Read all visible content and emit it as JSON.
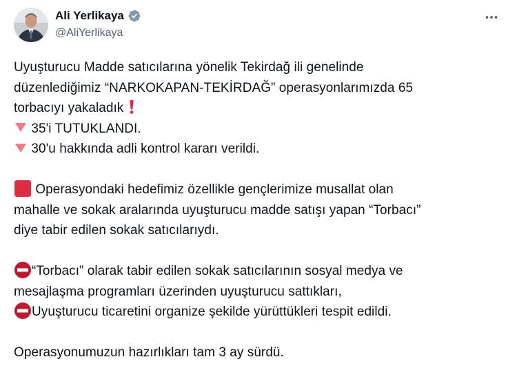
{
  "author": {
    "name": "Ali Yerlikaya",
    "handle": "@AliYerlikaya",
    "verified": true
  },
  "icons": {
    "more": "more-horizontal-icon",
    "verified": "verified-badge-icon",
    "exclamation": "red-exclamation-icon",
    "down": "red-down-triangle-icon",
    "square": "red-square-icon",
    "no_entry": "no-entry-icon"
  },
  "colors": {
    "verified_badge": "#829aab",
    "emoji_red": "#dd2e44",
    "no_entry_red": "#be1931",
    "text": "#0f1419",
    "muted": "#536471"
  },
  "tweet": {
    "line1": "Uyuşturucu Madde satıcılarına yönelik Tekirdağ ili genelinde",
    "line2": "düzenlediğimiz “NARKOKAPAN-TEKİRDAĞ” operasyonlarımızda 65",
    "line3": "torbacıyı yakaladık",
    "line4": "35'i TUTUKLANDI.",
    "line5": "30'u hakkında adli kontrol kararı verildi.",
    "line6": "Operasyondaki hedefimiz özellikle gençlerimize musallat olan",
    "line7": "mahalle ve sokak aralarında uyuşturucu madde satışı yapan “Torbacı”",
    "line8": "diye tabir edilen sokak satıcılarıydı.",
    "line9": "“Torbacı” olarak tabir edilen sokak satıcılarının sosyal medya ve",
    "line10": "mesajlaşma programları üzerinden uyuşturucu sattıkları,",
    "line11": "Uyuşturucu ticaretini organize şekilde yürüttükleri tespit edildi.",
    "line12": "Operasyonumuzun hazırlıkları tam 3 ay sürdü."
  }
}
